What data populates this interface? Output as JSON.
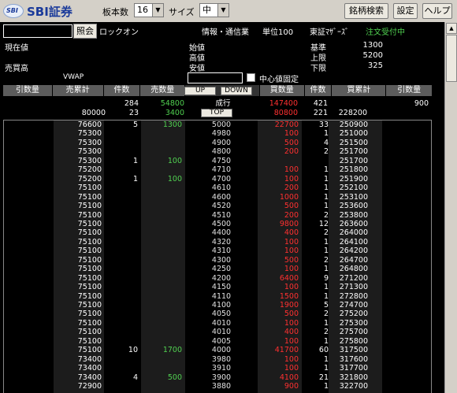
{
  "toolbar": {
    "logo_mark": "SBI",
    "logo_text": "SBI証券",
    "board_count_label": "板本数",
    "board_count_value": "16",
    "size_label": "サイズ",
    "size_value": "中",
    "search_button": "銘柄検索",
    "settings_button": "設定",
    "help_button": "ヘルプ"
  },
  "info": {
    "query_button": "照会",
    "stock_name": "ロックオン",
    "sector": "情報・通信業",
    "unit_label": "単位100",
    "market": "東証ﾏｻﾞｰｽﾞ",
    "order_status": "注文受付中",
    "current_price_label": "現在値",
    "open_label": "始値",
    "base_label": "基準",
    "base_value": "1300",
    "high_label": "高値",
    "upper_limit_label": "上限",
    "upper_limit_value": "5200",
    "volume_label": "売買高",
    "low_label": "安値",
    "lower_limit_label": "下限",
    "lower_limit_value": "325",
    "vwap_label": "VWAP",
    "center_fixed_label": "中心値固定"
  },
  "board_header": {
    "cols": [
      "引数量",
      "売累計",
      "件数",
      "売数量",
      "",
      "買数量",
      "件数",
      "買累計",
      "引数量"
    ],
    "up_button": "UP",
    "down_button": "DOWN"
  },
  "market_row": {
    "sell_count": "284",
    "sell_qty": "54800",
    "label": "成行",
    "buy_qty": "147400",
    "buy_count": "421",
    "buy_close_qty": "900"
  },
  "over_row": {
    "sell_cum": "80000",
    "sell_count": "23",
    "sell_qty": "3400",
    "label": "TOP",
    "buy_qty": "80800",
    "buy_count": "221",
    "buy_cum": "228200"
  },
  "ladder": [
    {
      "sc": "76600",
      "sn": "5",
      "sq": "1300",
      "p": "5000",
      "bq": "22700",
      "bn": "33",
      "bc": "250900"
    },
    {
      "sc": "75300",
      "sn": "",
      "sq": "",
      "p": "4980",
      "bq": "100",
      "bn": "1",
      "bc": "251000"
    },
    {
      "sc": "75300",
      "sn": "",
      "sq": "",
      "p": "4900",
      "bq": "500",
      "bn": "4",
      "bc": "251500"
    },
    {
      "sc": "75300",
      "sn": "",
      "sq": "",
      "p": "4800",
      "bq": "200",
      "bn": "2",
      "bc": "251700"
    },
    {
      "sc": "75300",
      "sn": "1",
      "sq": "100",
      "p": "4750",
      "bq": "",
      "bn": "",
      "bc": "251700"
    },
    {
      "sc": "75200",
      "sn": "",
      "sq": "",
      "p": "4710",
      "bq": "100",
      "bn": "1",
      "bc": "251800"
    },
    {
      "sc": "75200",
      "sn": "1",
      "sq": "100",
      "p": "4700",
      "bq": "100",
      "bn": "1",
      "bc": "251900"
    },
    {
      "sc": "75100",
      "sn": "",
      "sq": "",
      "p": "4610",
      "bq": "200",
      "bn": "1",
      "bc": "252100"
    },
    {
      "sc": "75100",
      "sn": "",
      "sq": "",
      "p": "4600",
      "bq": "1000",
      "bn": "1",
      "bc": "253100"
    },
    {
      "sc": "75100",
      "sn": "",
      "sq": "",
      "p": "4520",
      "bq": "500",
      "bn": "1",
      "bc": "253600"
    },
    {
      "sc": "75100",
      "sn": "",
      "sq": "",
      "p": "4510",
      "bq": "200",
      "bn": "2",
      "bc": "253800"
    },
    {
      "sc": "75100",
      "sn": "",
      "sq": "",
      "p": "4500",
      "bq": "9800",
      "bn": "12",
      "bc": "263600"
    },
    {
      "sc": "75100",
      "sn": "",
      "sq": "",
      "p": "4400",
      "bq": "400",
      "bn": "2",
      "bc": "264000"
    },
    {
      "sc": "75100",
      "sn": "",
      "sq": "",
      "p": "4320",
      "bq": "100",
      "bn": "1",
      "bc": "264100"
    },
    {
      "sc": "75100",
      "sn": "",
      "sq": "",
      "p": "4310",
      "bq": "100",
      "bn": "1",
      "bc": "264200"
    },
    {
      "sc": "75100",
      "sn": "",
      "sq": "",
      "p": "4300",
      "bq": "500",
      "bn": "2",
      "bc": "264700"
    },
    {
      "sc": "75100",
      "sn": "",
      "sq": "",
      "p": "4250",
      "bq": "100",
      "bn": "1",
      "bc": "264800"
    },
    {
      "sc": "75100",
      "sn": "",
      "sq": "",
      "p": "4200",
      "bq": "6400",
      "bn": "9",
      "bc": "271200"
    },
    {
      "sc": "75100",
      "sn": "",
      "sq": "",
      "p": "4150",
      "bq": "100",
      "bn": "1",
      "bc": "271300"
    },
    {
      "sc": "75100",
      "sn": "",
      "sq": "",
      "p": "4110",
      "bq": "1500",
      "bn": "1",
      "bc": "272800"
    },
    {
      "sc": "75100",
      "sn": "",
      "sq": "",
      "p": "4100",
      "bq": "1900",
      "bn": "5",
      "bc": "274700"
    },
    {
      "sc": "75100",
      "sn": "",
      "sq": "",
      "p": "4050",
      "bq": "500",
      "bn": "2",
      "bc": "275200"
    },
    {
      "sc": "75100",
      "sn": "",
      "sq": "",
      "p": "4010",
      "bq": "100",
      "bn": "1",
      "bc": "275300"
    },
    {
      "sc": "75100",
      "sn": "",
      "sq": "",
      "p": "4010",
      "bq": "400",
      "bn": "2",
      "bc": "275700"
    },
    {
      "sc": "75100",
      "sn": "",
      "sq": "",
      "p": "4005",
      "bq": "100",
      "bn": "1",
      "bc": "275800"
    },
    {
      "sc": "75100",
      "sn": "10",
      "sq": "1700",
      "p": "4000",
      "bq": "41700",
      "bn": "60",
      "bc": "317500"
    },
    {
      "sc": "73400",
      "sn": "",
      "sq": "",
      "p": "3980",
      "bq": "100",
      "bn": "1",
      "bc": "317600"
    },
    {
      "sc": "73400",
      "sn": "",
      "sq": "",
      "p": "3910",
      "bq": "100",
      "bn": "1",
      "bc": "317700"
    },
    {
      "sc": "73400",
      "sn": "4",
      "sq": "500",
      "p": "3900",
      "bq": "4100",
      "bn": "21",
      "bc": "321800"
    },
    {
      "sc": "72900",
      "sn": "",
      "sq": "",
      "p": "3880",
      "bq": "900",
      "bn": "1",
      "bc": "322700"
    }
  ],
  "colors": {
    "sell_qty": "#50d050",
    "buy_qty": "#ff3030",
    "order_status": "#50d050",
    "header_bg": "#5c5c5c"
  }
}
